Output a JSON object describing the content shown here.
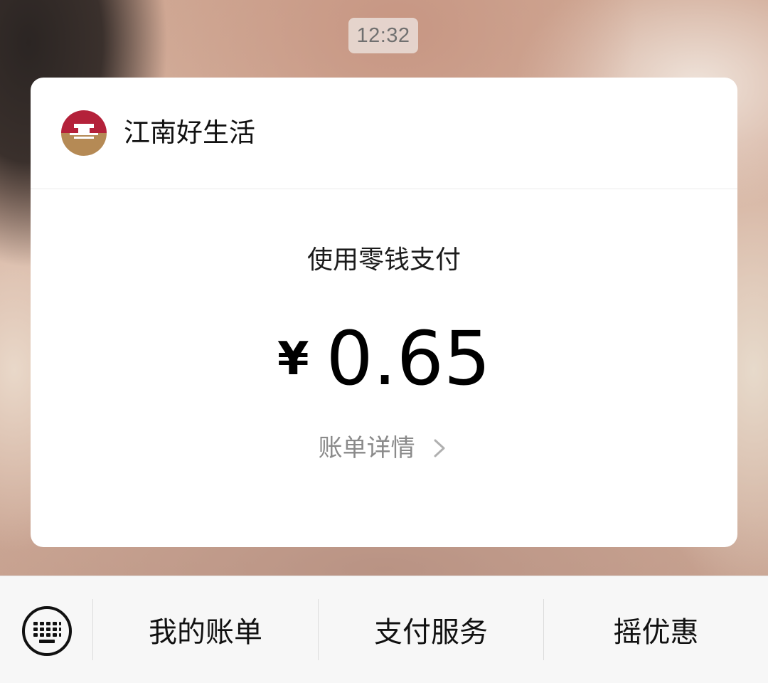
{
  "status": {
    "time": "12:32"
  },
  "card": {
    "merchant": {
      "name": "江南好生活",
      "logo_icon": "merchant-logo-icon"
    },
    "payment_method": "使用零钱支付",
    "amount": {
      "currency": "¥",
      "value": "0.65"
    },
    "details_link": "账单详情"
  },
  "bottom_menu": {
    "keyboard_icon": "keyboard-icon",
    "items": [
      {
        "label": "我的账单"
      },
      {
        "label": "支付服务"
      },
      {
        "label": "摇优惠"
      }
    ]
  },
  "colors": {
    "logo_red": "#b4213a",
    "logo_gold": "#b58a55",
    "card_bg": "#ffffff",
    "bar_bg": "#f7f7f7",
    "muted_text": "#8a8a8a"
  }
}
